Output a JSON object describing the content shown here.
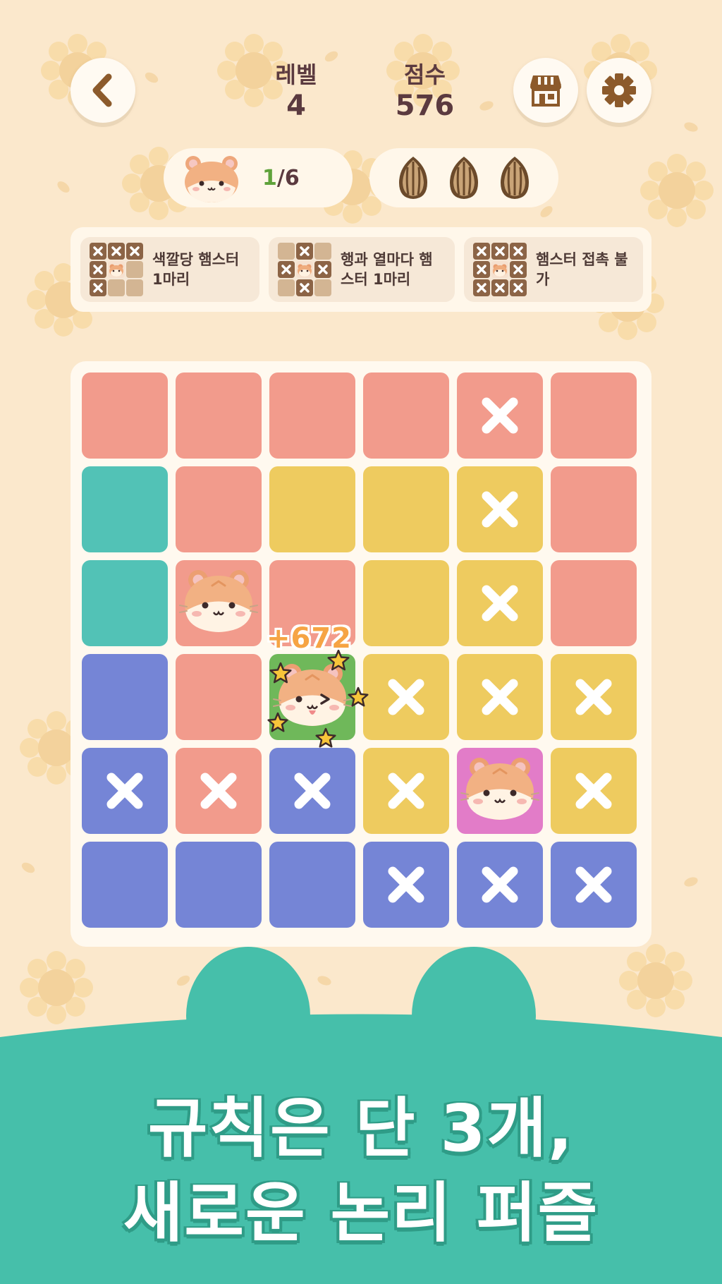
{
  "colors": {
    "background": "#fbe8cc",
    "coral": "#f29b8c",
    "teal": "#52c2b6",
    "yellow": "#eecb5f",
    "blue": "#7585d6",
    "pink": "#e27cc8",
    "green": "#6fb85a",
    "footer": "#46bfaa"
  },
  "header": {
    "back_icon": "chevron-left-icon",
    "level_label": "레벨",
    "level_value": "4",
    "score_label": "점수",
    "score_value": "576",
    "shop_icon": "shop-icon",
    "settings_icon": "gear-icon"
  },
  "status": {
    "hamster_icon": "hamster-icon",
    "progress_current": "1",
    "progress_total": "/6",
    "seeds_icon": "sunflower-seed-icon",
    "seeds_count": 3
  },
  "rules": [
    {
      "icon": "rule-color-grid-icon",
      "text": "색깔당 햄스터 1마리"
    },
    {
      "icon": "rule-row-col-grid-icon",
      "text": "행과 열마다 햄스터 1마리"
    },
    {
      "icon": "rule-adjacent-grid-icon",
      "text": "햄스터 접촉 불가"
    }
  ],
  "board": {
    "size": 6,
    "cells": [
      [
        "coral",
        "coral",
        "coral",
        "coral",
        "coral",
        "coral"
      ],
      [
        "teal",
        "coral",
        "yellow",
        "yellow",
        "yellow",
        "coral"
      ],
      [
        "teal",
        "coral",
        "coral",
        "yellow",
        "yellow",
        "coral"
      ],
      [
        "blue",
        "coral",
        "green",
        "yellow",
        "yellow",
        "yellow"
      ],
      [
        "blue",
        "coral",
        "blue",
        "yellow",
        "pink",
        "yellow"
      ],
      [
        "blue",
        "blue",
        "blue",
        "blue",
        "blue",
        "blue"
      ]
    ],
    "marks": [
      [
        "",
        "",
        "",
        "",
        "x",
        ""
      ],
      [
        "",
        "",
        "",
        "",
        "x",
        ""
      ],
      [
        "",
        "hamster",
        "",
        "",
        "x",
        ""
      ],
      [
        "",
        "",
        "hamster-happy",
        "x",
        "x",
        "x"
      ],
      [
        "x",
        "x",
        "x",
        "x",
        "hamster",
        "x"
      ],
      [
        "",
        "",
        "",
        "x",
        "x",
        "x"
      ]
    ],
    "score_popup": "+672"
  },
  "promo": {
    "line1": "규칙은 단 3개,",
    "line2": "새로운 논리 퍼즐"
  }
}
